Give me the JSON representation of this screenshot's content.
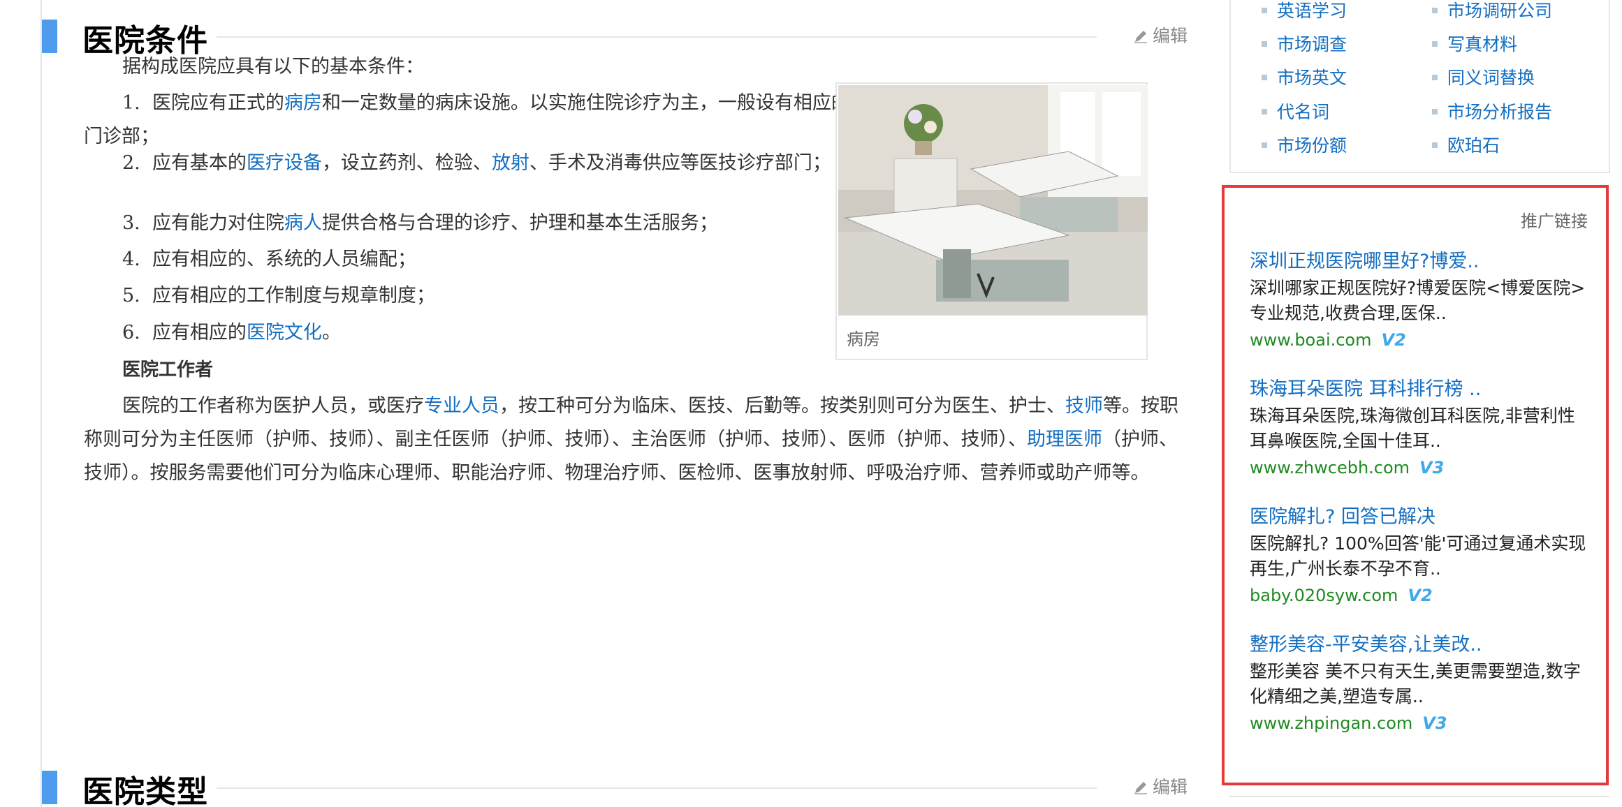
{
  "sections": [
    {
      "title": "医院条件",
      "edit": "编辑"
    },
    {
      "title": "医院类型",
      "edit": "编辑"
    }
  ],
  "intro": "据构成医院应具有以下的基本条件：",
  "items": [
    {
      "num": "1.",
      "pre": "医院应有正式的",
      "link": "病房",
      "post": "和一定数量的病床设施。以实施住院诊疗为主，一般设有相应的门诊部；"
    },
    {
      "num": "2.",
      "pre": "应有基本的",
      "link": "医疗设备",
      "mid": "，设立药剂、检验、",
      "link2": "放射",
      "post": "、手术及消毒供应等医技诊疗部门；"
    },
    {
      "num": "3.",
      "pre": "应有能力对住院",
      "link": "病人",
      "post": "提供合格与合理的诊疗、护理和基本生活服务；"
    },
    {
      "num": "4.",
      "text": "应有相应的、系统的人员编配；"
    },
    {
      "num": "5.",
      "text": "应有相应的工作制度与规章制度；"
    },
    {
      "num": "6.",
      "pre": "应有相应的",
      "link": "医院文化",
      "post": "。"
    }
  ],
  "workers_heading": "医院工作者",
  "workers": {
    "t1": "医院的工作者称为医护人员，或医疗",
    "l1": "专业人员",
    "t2": "，按工种可分为临床、医技、后勤等。按类别则可分为医生、护士、",
    "l2": "技师",
    "t3": "等。按职称则可分为主任医师（护师、技师）、副主任医师（护师、技师）、主治医师（护师、技师）、医师（护师、技师）、",
    "l3": "助理医师",
    "t4": "（护师、技师）。按服务需要他们可分为临床心理师、职能治疗师、物理治疗师、医检师、医事放射师、呼吸治疗师、营养师或助产师等。"
  },
  "figure": {
    "caption": "病房"
  },
  "related": [
    "英语学习",
    "市场调研公司",
    "市场调查",
    "写真材料",
    "市场英文",
    "同义词替换",
    "代名词",
    "市场分析报告",
    "市场份额",
    "欧珀石"
  ],
  "ads": {
    "label": "推广链接",
    "items": [
      {
        "title": "深圳正规医院哪里好?博爱..",
        "desc": "深圳哪家正规医院好?博爱医院<博爱医院>专业规范,收费合理,医保..",
        "url": "www.boai.com",
        "v": "V2"
      },
      {
        "title": "珠海耳朵医院 耳科排行榜 ..",
        "desc": "珠海耳朵医院,珠海微创耳科医院,非营利性耳鼻喉医院,全国十佳耳..",
        "url": "www.zhwcebh.com",
        "v": "V3"
      },
      {
        "title": "医院解扎? 回答已解决",
        "desc": "医院解扎? 100%回答'能'可通过复通术实现再生,广州长泰不孕不育..",
        "url": "baby.020syw.com",
        "v": "V2"
      },
      {
        "title": "整形美容-平安美容,让美改..",
        "desc": "整形美容 美不只有天生,美更需要塑造,数字化精细之美,塑造专属..",
        "url": "www.zhpingan.com",
        "v": "V3"
      }
    ]
  },
  "colors": {
    "accent": "#4f9cee",
    "link": "#136ec2",
    "url_green": "#1f8a21",
    "ad_border": "#e63a3a"
  }
}
